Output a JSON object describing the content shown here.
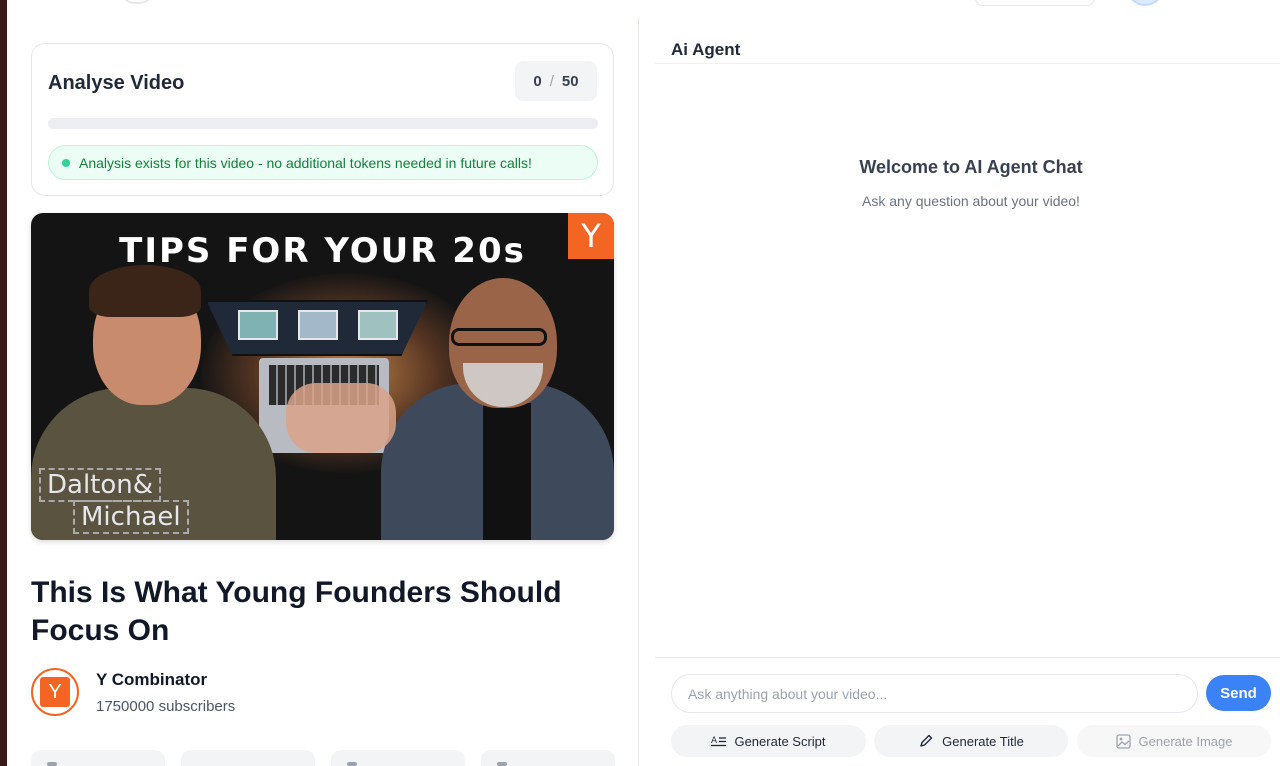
{
  "analyse": {
    "title": "Analyse Video",
    "count_used": "0",
    "count_separator": "/",
    "count_total": "50",
    "progress": 0,
    "status_message": "Analysis exists for this video - no additional tokens needed in future calls!"
  },
  "thumbnail": {
    "headline": "TIPS FOR YOUR 20s",
    "brand_mark": "Y",
    "name_line1": "Dalton&",
    "name_line2": "Michael"
  },
  "video": {
    "title": "This Is What Young Founders Should Focus On"
  },
  "channel": {
    "avatar_letter": "Y",
    "name": "Y Combinator",
    "subscribers": "1750000 subscribers"
  },
  "agent": {
    "title": "Ai Agent",
    "welcome_title": "Welcome to AI Agent Chat",
    "welcome_subtitle": "Ask any question about your video!",
    "input_placeholder": "Ask anything about your video...",
    "send_label": "Send",
    "actions": [
      {
        "label": "Generate Script",
        "icon": "script-icon",
        "enabled": true
      },
      {
        "label": "Generate Title",
        "icon": "pencil-icon",
        "enabled": true
      },
      {
        "label": "Generate Image",
        "icon": "image-icon",
        "enabled": false
      }
    ]
  },
  "colors": {
    "accent": "#3b82f6",
    "brand_orange": "#f26522",
    "success_text": "#15803d",
    "success_bg": "#ecfdf5"
  }
}
